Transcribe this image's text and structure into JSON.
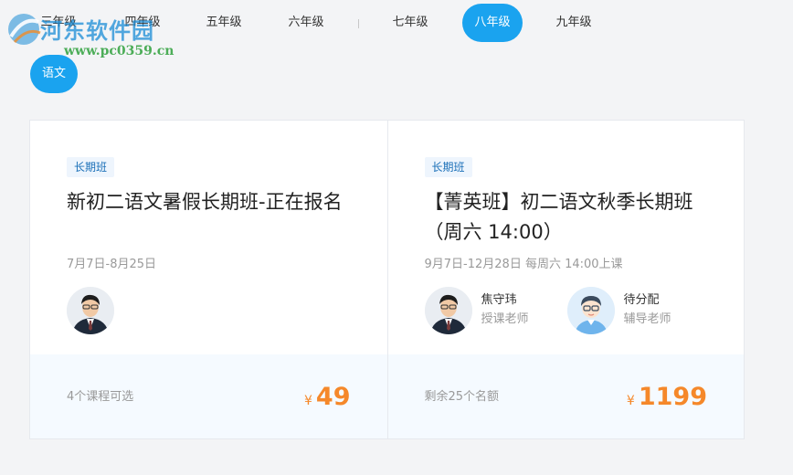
{
  "watermark": {
    "title": "河东软件园",
    "url": "www.pc0359.cn"
  },
  "grade_tabs": [
    {
      "label": "三年级",
      "active": false
    },
    {
      "label": "四年级",
      "active": false
    },
    {
      "label": "五年级",
      "active": false
    },
    {
      "label": "六年级",
      "active": false
    },
    {
      "label": "七年级",
      "active": false
    },
    {
      "label": "八年级",
      "active": true
    },
    {
      "label": "九年级",
      "active": false
    }
  ],
  "subject": {
    "label": "语文"
  },
  "courses": [
    {
      "tag": "长期班",
      "title": "新初二语文暑假长期班-正在报名",
      "date": "7月7日-8月25日",
      "teachers": [
        {
          "name": "",
          "role": "",
          "avatar": "teacher-photo"
        }
      ],
      "note": "4个课程可选",
      "currency": "¥",
      "price": "49"
    },
    {
      "tag": "长期班",
      "title": "【菁英班】初二语文秋季长期班（周六 14:00）",
      "date": "9月7日-12月28日 每周六 14:00上课",
      "teachers": [
        {
          "name": "焦守玮",
          "role": "授课老师",
          "avatar": "teacher-photo"
        },
        {
          "name": "待分配",
          "role": "辅导老师",
          "avatar": "placeholder-avatar"
        }
      ],
      "note": "剩余25个名额",
      "currency": "¥",
      "price": "1199"
    }
  ],
  "colors": {
    "accent": "#1aa3ef",
    "price": "#f5882a",
    "tag_text": "#1a6fb8"
  }
}
